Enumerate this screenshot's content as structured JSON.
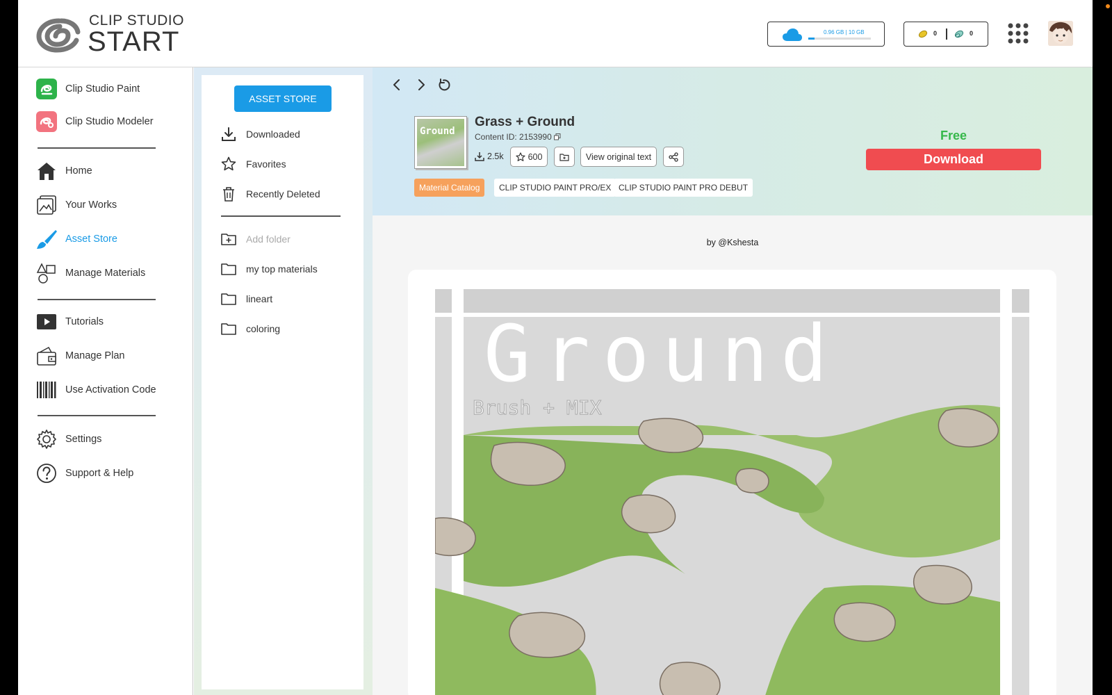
{
  "header": {
    "logo_line1": "CLIP STUDIO",
    "logo_line2": "START",
    "cloud_text": "0.96 GB | 10 GB",
    "cloud_used_fraction": 0.096,
    "points_gold": "0",
    "points_blue": "0"
  },
  "leftnav": {
    "items": [
      {
        "label": "Clip Studio Paint",
        "icon": "clip-studio-paint-icon"
      },
      {
        "label": "Clip Studio Modeler",
        "icon": "clip-studio-modeler-icon"
      },
      {
        "label": "Home",
        "icon": "home-icon"
      },
      {
        "label": "Your Works",
        "icon": "your-works-icon"
      },
      {
        "label": "Asset Store",
        "icon": "brush-icon"
      },
      {
        "label": "Manage Materials",
        "icon": "shapes-icon"
      },
      {
        "label": "Tutorials",
        "icon": "play-icon"
      },
      {
        "label": "Manage Plan",
        "icon": "wallet-icon"
      },
      {
        "label": "Use Activation Code",
        "icon": "barcode-icon"
      },
      {
        "label": "Settings",
        "icon": "gear-icon"
      },
      {
        "label": "Support & Help",
        "icon": "help-icon"
      }
    ]
  },
  "matpanel": {
    "asset_store_button": "ASSET STORE",
    "items": [
      {
        "label": "Downloaded"
      },
      {
        "label": "Favorites"
      },
      {
        "label": "Recently Deleted"
      },
      {
        "label": "Add folder"
      },
      {
        "label": "my top materials"
      },
      {
        "label": "lineart"
      },
      {
        "label": "coloring"
      }
    ]
  },
  "material": {
    "title": "Grass + Ground",
    "content_id": "Content ID: 2153990",
    "downloads": "2.5k",
    "favorites": "600",
    "view_original_text": "View original text",
    "tags": [
      "Material Catalog",
      "CLIP STUDIO PAINT PRO/EX",
      "CLIP STUDIO PAINT PRO DEBUT"
    ],
    "price": "Free",
    "download_button": "Download",
    "byline": "by @Kshesta",
    "thumb_text": "Ground",
    "preview_title": "Ground",
    "preview_subtitle": "Brush + MIX"
  },
  "colors": {
    "accent_blue": "#1a9be6",
    "download_red": "#f04c50",
    "free_green": "#36b84a",
    "catalog_orange": "#f6a15c"
  }
}
